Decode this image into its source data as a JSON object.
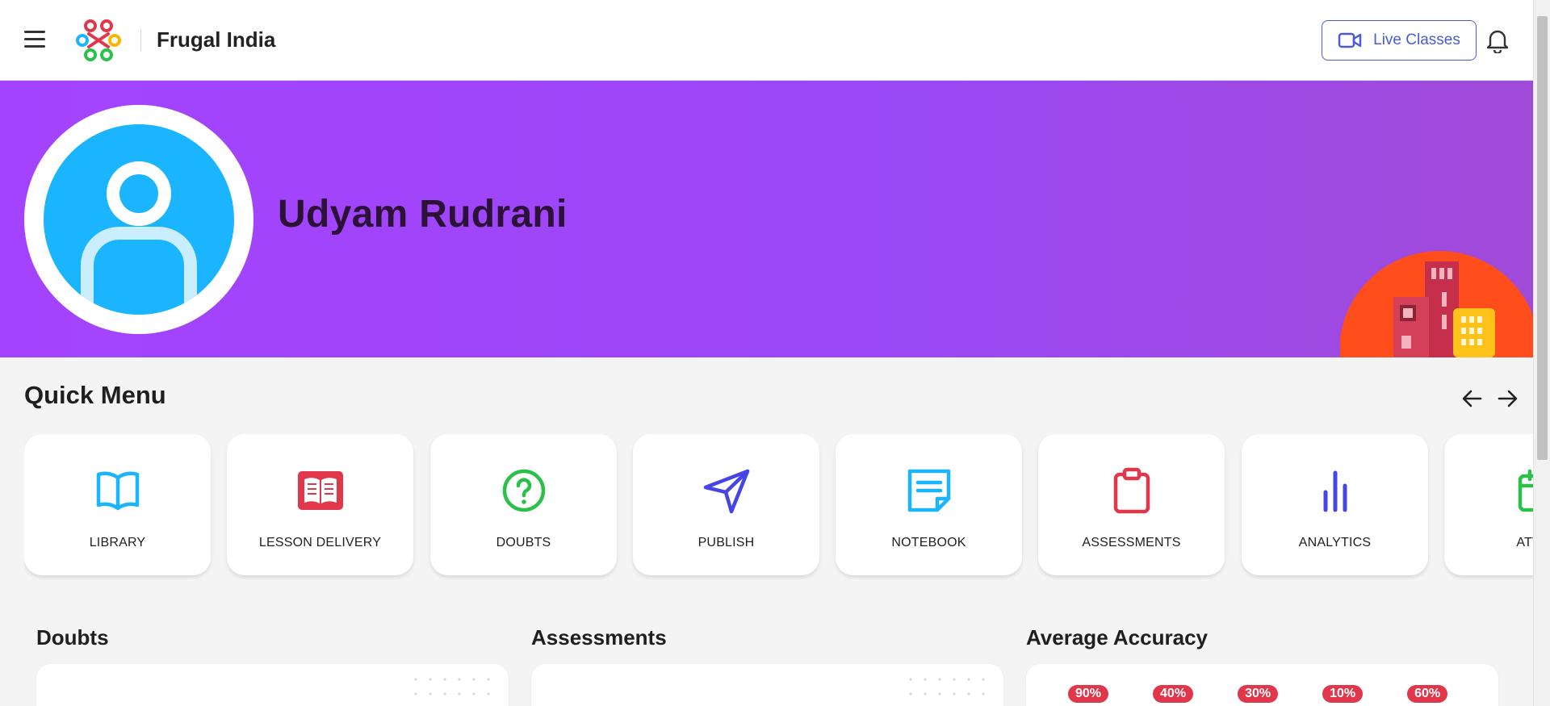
{
  "header": {
    "org_name": "Frugal India",
    "live_classes_label": "Live Classes"
  },
  "profile": {
    "name": "Udyam Rudrani"
  },
  "quick_menu": {
    "title": "Quick Menu",
    "items": [
      {
        "label": "LIBRARY",
        "icon": "book-open-icon",
        "color": "#1bb5ff"
      },
      {
        "label": "LESSON DELIVERY",
        "icon": "lesson-book-icon",
        "color": "#e0384a"
      },
      {
        "label": "DOUBTS",
        "icon": "question-circle-icon",
        "color": "#2ac04a"
      },
      {
        "label": "PUBLISH",
        "icon": "paper-plane-icon",
        "color": "#4545e6"
      },
      {
        "label": "NOTEBOOK",
        "icon": "note-icon",
        "color": "#1bb5ff"
      },
      {
        "label": "ASSESSMENTS",
        "icon": "clipboard-icon",
        "color": "#e0384a"
      },
      {
        "label": "ANALYTICS",
        "icon": "bar-chart-icon",
        "color": "#4545e6"
      },
      {
        "label": "ATTEN",
        "icon": "calendar-icon",
        "color": "#2ac04a"
      }
    ]
  },
  "sections": {
    "doubts": "Doubts",
    "assessments": "Assessments",
    "average_accuracy": "Average Accuracy"
  },
  "accuracy_values": [
    "90%",
    "40%",
    "30%",
    "10%",
    "60%"
  ],
  "colors": {
    "banner": "#a443ff",
    "accent": "#4b5bd6",
    "avatar": "#1bb5ff",
    "badge": "#e0384a"
  }
}
